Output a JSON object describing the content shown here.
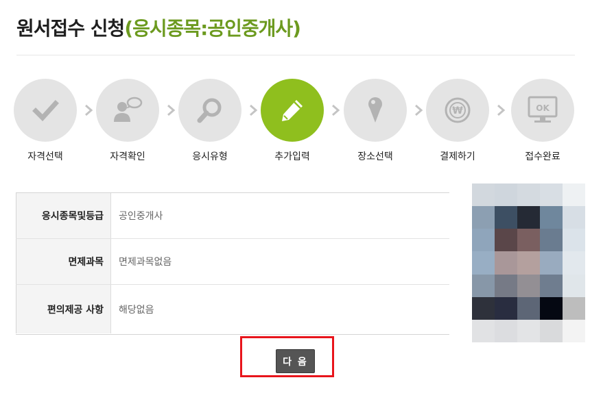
{
  "header": {
    "title": "원서접수 신청",
    "subtitle": "(응시종목:공인중개사)",
    "subtitle_color": "#6c9a1f"
  },
  "steps": [
    {
      "label": "자격선택",
      "icon": "check-icon",
      "active": false
    },
    {
      "label": "자격확인",
      "icon": "person-speech-icon",
      "active": false
    },
    {
      "label": "응시유형",
      "icon": "magnifier-icon",
      "active": false
    },
    {
      "label": "추가입력",
      "icon": "pencil-icon",
      "active": true
    },
    {
      "label": "장소선택",
      "icon": "location-pin-icon",
      "active": false
    },
    {
      "label": "결제하기",
      "icon": "won-coin-icon",
      "active": false
    },
    {
      "label": "접수완료",
      "icon": "monitor-ok-icon",
      "active": false
    }
  ],
  "step_icon_text": {
    "ok": "OK",
    "won": "₩"
  },
  "colors": {
    "active_step": "#8fbf1e",
    "inactive_step": "#e4e4e4",
    "highlight": "#e8141b",
    "button": "#555555"
  },
  "info": {
    "rows": [
      {
        "label": "응시종목및등급",
        "value": "공인중개사"
      },
      {
        "label": "면제과목",
        "value": "면제과목없음"
      },
      {
        "label": "편의제공 사항",
        "value": "해당없음"
      }
    ]
  },
  "photo": {
    "description_icon": "applicant-photo-blurred"
  },
  "actions": {
    "next_label": "다 음"
  }
}
